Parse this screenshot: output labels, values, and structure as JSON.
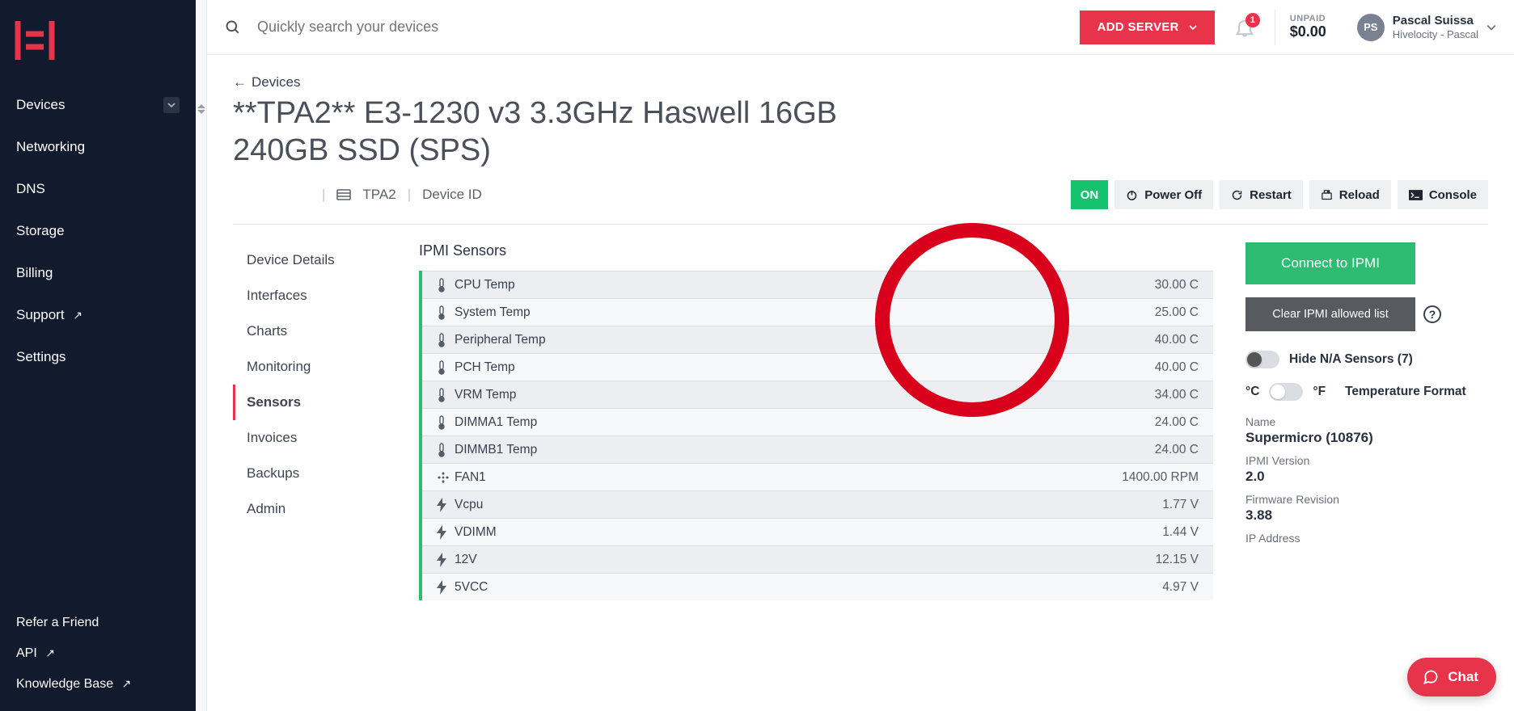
{
  "sidebar": {
    "items": [
      {
        "label": "Devices",
        "has_chevron": true
      },
      {
        "label": "Networking"
      },
      {
        "label": "DNS"
      },
      {
        "label": "Storage"
      },
      {
        "label": "Billing"
      },
      {
        "label": "Support",
        "ext": true
      },
      {
        "label": "Settings"
      }
    ],
    "bottom": [
      {
        "label": "Refer a Friend"
      },
      {
        "label": "API",
        "ext": true
      },
      {
        "label": "Knowledge Base",
        "ext": true
      }
    ]
  },
  "topbar": {
    "search_placeholder": "Quickly search your devices",
    "add_server": "ADD SERVER",
    "notif_count": "1",
    "unpaid_label": "UNPAID",
    "unpaid_amount": "$0.00",
    "user_initials": "PS",
    "user_name": "Pascal Suissa",
    "user_org": "Hivelocity - Pascal"
  },
  "page": {
    "back": "Devices",
    "title": "**TPA2** E3-1230 v3 3.3GHz Haswell 16GB 240GB SSD (SPS)",
    "facility": "TPA2",
    "device_id_label": "Device ID",
    "device_id_value": "",
    "power": "ON",
    "btn_power_off": "Power Off",
    "btn_restart": "Restart",
    "btn_reload": "Reload",
    "btn_console": "Console"
  },
  "leftnav": [
    "Device Details",
    "Interfaces",
    "Charts",
    "Monitoring",
    "Sensors",
    "Invoices",
    "Backups",
    "Admin"
  ],
  "leftnav_active": "Sensors",
  "sensors": {
    "heading": "IPMI Sensors",
    "rows": [
      {
        "icon": "thermo",
        "name": "CPU Temp",
        "value": "30.00 C"
      },
      {
        "icon": "thermo",
        "name": "System Temp",
        "value": "25.00 C"
      },
      {
        "icon": "thermo",
        "name": "Peripheral Temp",
        "value": "40.00 C"
      },
      {
        "icon": "thermo",
        "name": "PCH Temp",
        "value": "40.00 C"
      },
      {
        "icon": "thermo",
        "name": "VRM Temp",
        "value": "34.00 C"
      },
      {
        "icon": "thermo",
        "name": "DIMMA1 Temp",
        "value": "24.00 C"
      },
      {
        "icon": "thermo",
        "name": "DIMMB1 Temp",
        "value": "24.00 C"
      },
      {
        "icon": "fan",
        "name": "FAN1",
        "value": "1400.00 RPM"
      },
      {
        "icon": "bolt",
        "name": "Vcpu",
        "value": "1.77 V"
      },
      {
        "icon": "bolt",
        "name": "VDIMM",
        "value": "1.44 V"
      },
      {
        "icon": "bolt",
        "name": "12V",
        "value": "12.15 V"
      },
      {
        "icon": "bolt",
        "name": "5VCC",
        "value": "4.97 V"
      }
    ]
  },
  "right": {
    "connect": "Connect to IPMI",
    "clear": "Clear IPMI allowed list",
    "hide_na": "Hide N/A Sensors (7)",
    "unit_c": "°C",
    "unit_f": "°F",
    "temp_format": "Temperature Format",
    "name_label": "Name",
    "name_value": "Supermicro (10876)",
    "ipmi_ver_label": "IPMI Version",
    "ipmi_ver_value": "2.0",
    "fw_label": "Firmware Revision",
    "fw_value": "3.88",
    "ip_label": "IP Address"
  },
  "chat": "Chat"
}
